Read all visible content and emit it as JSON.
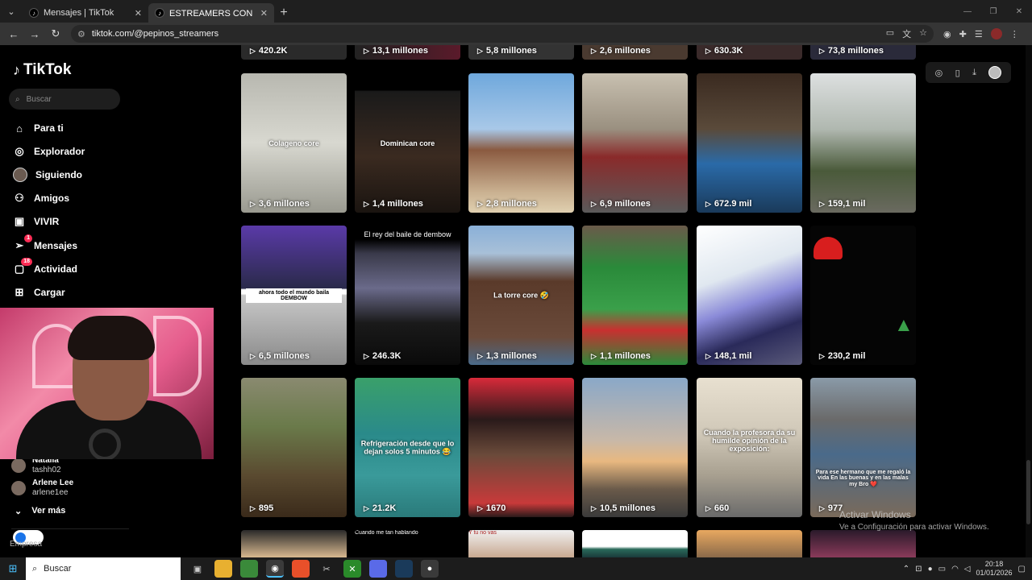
{
  "browser": {
    "tabs": [
      {
        "title": "Mensajes | TikTok",
        "active": false
      },
      {
        "title": "ESTREAMERS CON PEPINO 🥒",
        "active": true
      }
    ],
    "url": "tiktok.com/@pepinos_streamers"
  },
  "sidebar": {
    "brand": "TikTok",
    "search_placeholder": "Buscar",
    "items": [
      {
        "label": "Para ti",
        "icon": "home-icon"
      },
      {
        "label": "Explorador",
        "icon": "compass-icon"
      },
      {
        "label": "Siguiendo",
        "icon": "avatar-icon"
      },
      {
        "label": "Amigos",
        "icon": "friends-icon"
      },
      {
        "label": "VIVIR",
        "icon": "live-icon"
      },
      {
        "label": "Mensajes",
        "icon": "send-icon",
        "badge": "1"
      },
      {
        "label": "Actividad",
        "icon": "inbox-icon",
        "badge": "18"
      },
      {
        "label": "Cargar",
        "icon": "plus-box-icon"
      }
    ],
    "following": [
      {
        "name": "Natalia",
        "handle": "tashh02"
      },
      {
        "name": "Arlene Lee",
        "handle": "arlene1ee"
      }
    ],
    "see_more": "Ver más",
    "footer": "Empresa"
  },
  "grid": {
    "top_partial_views": [
      "420.2K",
      "13,1 millones",
      "5,8 millones",
      "2,6 millones",
      "630.3K",
      "73,8 millones"
    ],
    "rows": [
      [
        {
          "views": "3,6 millones",
          "caption": "Colageno core"
        },
        {
          "views": "1,4 millones",
          "caption": "Dominican core"
        },
        {
          "views": "2,8 millones",
          "caption": ""
        },
        {
          "views": "6,9 millones",
          "caption": ""
        },
        {
          "views": "672.9 mil",
          "caption": ""
        },
        {
          "views": "159,1 mil",
          "caption": ""
        }
      ],
      [
        {
          "views": "6,5 millones",
          "caption": "ahora todo el mundo baila DEMBOW"
        },
        {
          "views": "246.3K",
          "caption": "El rey del baile de dembow"
        },
        {
          "views": "1,3 millones",
          "caption": "La torre core 🤣"
        },
        {
          "views": "1,1 millones",
          "caption": ""
        },
        {
          "views": "148,1 mil",
          "caption": ""
        },
        {
          "views": "230,2 mil",
          "caption": ""
        }
      ],
      [
        {
          "views": "895",
          "caption": ""
        },
        {
          "views": "21.2K",
          "caption": "Refrigeración desde que lo dejan solos 5 minutos 😂"
        },
        {
          "views": "1670",
          "caption": ""
        },
        {
          "views": "10,5 millones",
          "caption": ""
        },
        {
          "views": "660",
          "caption": "Cuando la profesora da su humilde opinión de la exposición:"
        },
        {
          "views": "977",
          "caption": "Para ese hermano que me regaló la vida En las buenas y en las malas my Bro ❤️"
        }
      ]
    ],
    "bottom_partial_captions": [
      "",
      "Cuando me tan hablando",
      "Y tu no vas",
      "",
      "",
      ""
    ]
  },
  "windows_watermark": {
    "title": "Activar Windows",
    "subtitle": "Ve a Configuración para activar Windows."
  },
  "taskbar": {
    "search": "Buscar",
    "time": "20:18",
    "date": "01/01/2026"
  }
}
